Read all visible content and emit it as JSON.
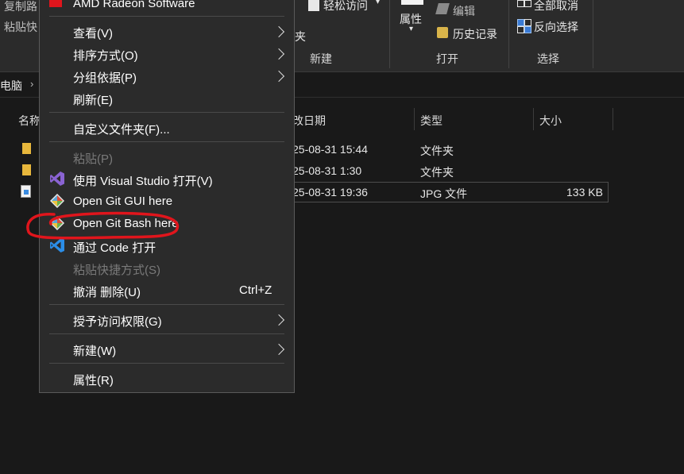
{
  "ribbon": {
    "clipboard": {
      "copy_path": "复制路",
      "paste_shortcut": "粘贴快"
    },
    "new_group": {
      "easy_access": "轻松访问",
      "partial_label": "夹",
      "label": "新建"
    },
    "open_group": {
      "properties": "属性",
      "edit": "编辑",
      "history": "历史记录",
      "label": "打开"
    },
    "select_group": {
      "select_none": "全部取消",
      "invert_selection": "反向选择",
      "label": "选择"
    }
  },
  "address": {
    "location": "电脑"
  },
  "columns": {
    "name": "名称",
    "date": "改日期",
    "type": "类型",
    "size": "大小"
  },
  "files": [
    {
      "date": "25-08-31 15:44",
      "type": "文件夹",
      "size": ""
    },
    {
      "date": "25-08-31 1:30",
      "type": "文件夹",
      "size": ""
    },
    {
      "date": "25-08-31 19:36",
      "type": "JPG 文件",
      "size": "133 KB"
    }
  ],
  "context_menu": {
    "top_item": "AMD Radeon Software",
    "items": [
      {
        "label": "查看(V)",
        "submenu": true
      },
      {
        "label": "排序方式(O)",
        "submenu": true
      },
      {
        "label": "分组依据(P)",
        "submenu": true
      },
      {
        "label": "刷新(E)"
      },
      {
        "label": "自定义文件夹(F)..."
      },
      {
        "label": "粘贴(P)",
        "disabled": true
      },
      {
        "label": "使用 Visual Studio 打开(V)",
        "icon": "visual-studio-icon"
      },
      {
        "label": "Open Git GUI here",
        "icon": "git-icon"
      },
      {
        "label": "Open Git Bash here",
        "icon": "git-icon"
      },
      {
        "label": "通过 Code 打开",
        "icon": "vscode-icon"
      },
      {
        "label": "粘贴快捷方式(S)",
        "disabled": true
      },
      {
        "label": "撤消 删除(U)",
        "shortcut": "Ctrl+Z"
      },
      {
        "label": "授予访问权限(G)",
        "submenu": true
      },
      {
        "label": "新建(W)",
        "submenu": true
      },
      {
        "label": "属性(R)"
      }
    ]
  },
  "colors": {
    "background": "#191919",
    "menu_background": "#2b2b2b",
    "annotation_circle": "#e0151c",
    "folder": "#e8b73c"
  }
}
